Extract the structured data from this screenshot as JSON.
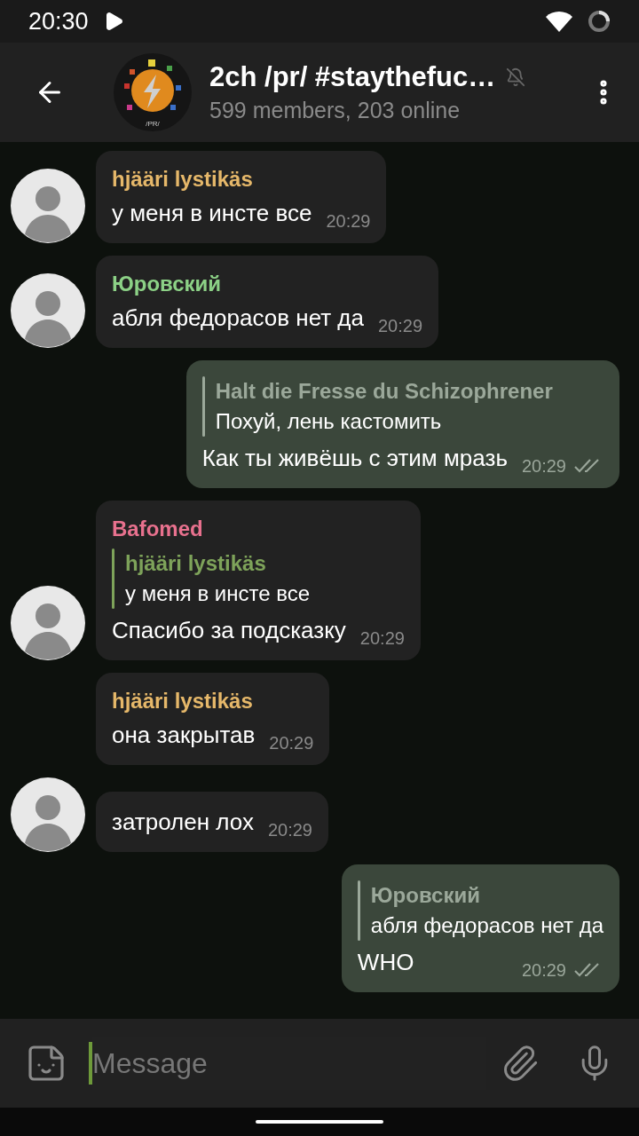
{
  "status_bar": {
    "time": "20:30"
  },
  "header": {
    "title": "2ch /pr/ #staythefuc…",
    "subtitle": "599 members, 203 online",
    "muted": true,
    "logo_caption": "/PR/"
  },
  "messages": [
    {
      "kind": "incoming",
      "sender": "hjääri lystikäs",
      "color": "#e6b86a",
      "avatar": true,
      "text": "у меня в инсте все",
      "time": "20:29"
    },
    {
      "kind": "incoming",
      "sender": "Юровский",
      "color": "#8cd186",
      "avatar": true,
      "text": "абля федорасов нет да",
      "time": "20:29"
    },
    {
      "kind": "outgoing",
      "reply": {
        "name": "Halt die Fresse du Schizophrener",
        "text": "Похуй, лень кастомить",
        "color": "#9ba89a"
      },
      "text": "Как ты живёшь с этим мразь",
      "time": "20:29",
      "read": true
    },
    {
      "kind": "incoming",
      "sender": "Bafomed",
      "color": "#e8718e",
      "avatar": true,
      "reply": {
        "name": "hjääri lystikäs",
        "text": "у меня в инсте все",
        "color": "#7ea35a"
      },
      "text": "Спасибо за подсказку",
      "time": "20:29"
    },
    {
      "kind": "incoming",
      "sender": "hjääri lystikäs",
      "color": "#e6b86a",
      "avatar": false,
      "text": "она закрытав",
      "time": "20:29"
    },
    {
      "kind": "incoming",
      "avatar": true,
      "text": "затролен лох",
      "time": "20:29"
    },
    {
      "kind": "outgoing",
      "reply": {
        "name": "Юровский",
        "text": "абля федорасов нет да",
        "color": "#9ba89a"
      },
      "text": "WHO",
      "time": "20:29",
      "read": true
    }
  ],
  "composer": {
    "placeholder": "Message"
  }
}
